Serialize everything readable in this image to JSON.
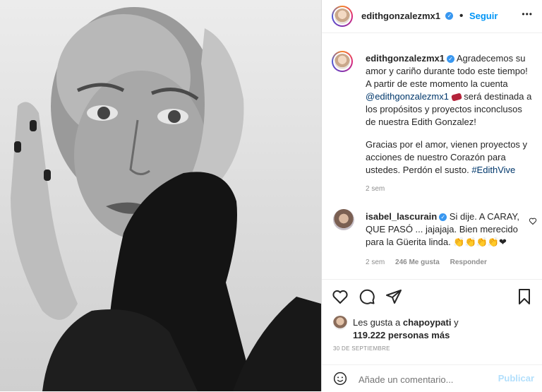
{
  "post": {
    "username": "edithgonzalezmx1",
    "follow_label": "Seguir",
    "more_label": "•••",
    "caption": {
      "line1_rest": "Agradecemos su",
      "line2": "amor y cariño durante todo este tiempo!",
      "line3": "A partir de este momento la cuenta",
      "mention": "@edithgonzalezmx1",
      "line4_rest": "será destinada a",
      "line5": "los propósitos y proyectos inconclusos",
      "line6": "de nuestra Edith Gonzalez!",
      "line7": "Gracias por el amor, vienen proyectos y",
      "line8": "acciones de nuestro Corazón para",
      "line9": "ustedes. Perdón el susto.",
      "hashtag": "#EdithVive",
      "time": "2 sem"
    }
  },
  "comment": {
    "username": "isabel_lascurain",
    "text1": "Si dije. A CARAY,",
    "text2": "QUE PASÓ ... jajajaja. Bien merecido",
    "text3": "para la Güerita linda.",
    "emojis": "👏👏👏👏❤",
    "time": "2 sem",
    "likes": "246 Me gusta",
    "reply": "Responder"
  },
  "likes": {
    "line1_prefix": "Les gusta a",
    "user": "chapoypati",
    "line1_suffix": "y",
    "line2": "119.222 personas más"
  },
  "date": "30 DE SEPTIEMBRE",
  "add_comment": {
    "placeholder": "Añade un comentario...",
    "publish": "Publicar"
  },
  "icons": [
    "verified-badge",
    "heart-icon",
    "comment-icon",
    "share-icon",
    "bookmark-icon",
    "emoji-icon"
  ],
  "colors": {
    "accent": "#0095f6",
    "verified": "#3897f0",
    "link": "#00376b",
    "muted": "#8e8e8e"
  }
}
